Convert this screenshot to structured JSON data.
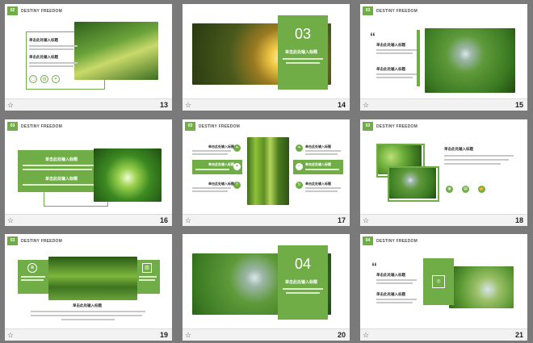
{
  "brand": "DESTINY FREEDOM",
  "slides": [
    {
      "number": "13",
      "tag": "02"
    },
    {
      "number": "14",
      "section": "03"
    },
    {
      "number": "15",
      "tag": "03"
    },
    {
      "number": "16",
      "tag": "03"
    },
    {
      "number": "17",
      "tag": "03"
    },
    {
      "number": "18",
      "tag": "03"
    },
    {
      "number": "19",
      "tag": "03"
    },
    {
      "number": "20",
      "section": "04"
    },
    {
      "number": "21",
      "tag": "04"
    }
  ],
  "star_icon": "star-icon",
  "colors": {
    "accent": "#70ad47",
    "background": "#7a7a7a"
  }
}
